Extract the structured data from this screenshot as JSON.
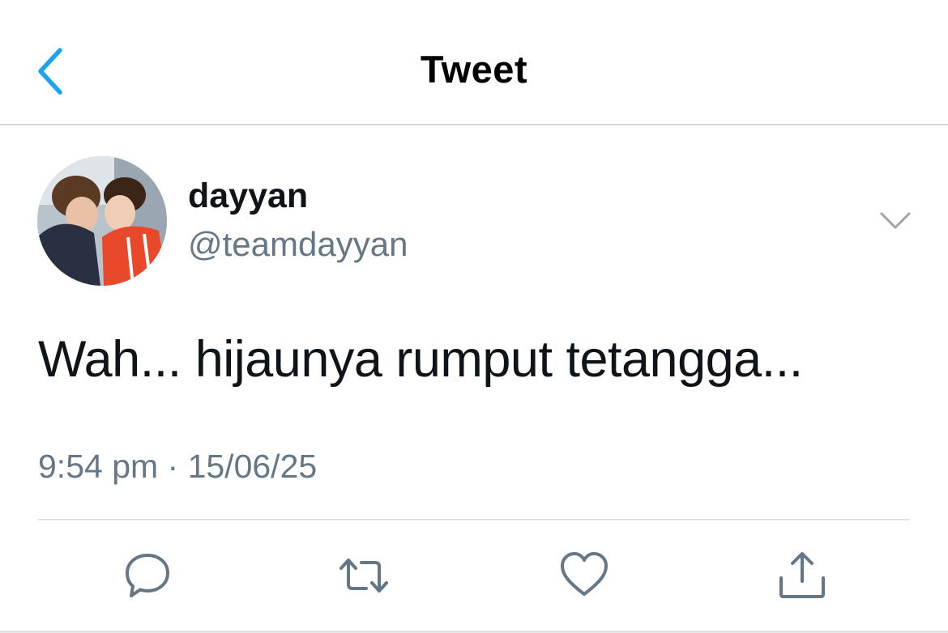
{
  "header": {
    "title": "Tweet",
    "back_icon": "chevron-left-icon"
  },
  "author": {
    "display_name": "dayyan",
    "handle": "@teamdayyan"
  },
  "tweet": {
    "text": "Wah... hijaunya rumput tetangga...",
    "timestamp": "9:54 pm · 15/06/25"
  },
  "actions": {
    "icons": [
      "reply-icon",
      "retweet-icon",
      "like-icon",
      "share-icon"
    ]
  },
  "colors": {
    "accent": "#1da1f2",
    "text": "#0f1419",
    "secondary": "#657786",
    "divider": "#e1e5e8"
  }
}
